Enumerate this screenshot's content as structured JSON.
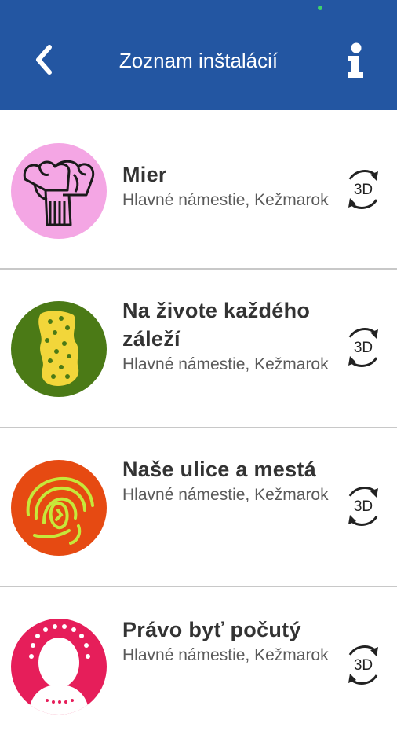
{
  "header": {
    "title": "Zoznam inštalácií",
    "back_icon": "chevron-left-icon",
    "info_icon": "info-icon",
    "color": "#2356a2"
  },
  "items": [
    {
      "name": "Mier",
      "place": "Hlavné námestie, Kežmarok",
      "thumb_color": "#f4a6e4",
      "action": "3D"
    },
    {
      "name": "Na živote každého záleží",
      "place": "Hlavné námestie, Kežmarok",
      "thumb_color": "#4b7a16",
      "action": "3D"
    },
    {
      "name": "Naše ulice a mestá",
      "place": "Hlavné námestie, Kežmarok",
      "thumb_color": "#e64a12",
      "action": "3D"
    },
    {
      "name": "Právo byť počutý",
      "place": "Hlavné námestie, Kežmarok",
      "thumb_color": "#e61e5a",
      "action": "3D"
    }
  ]
}
